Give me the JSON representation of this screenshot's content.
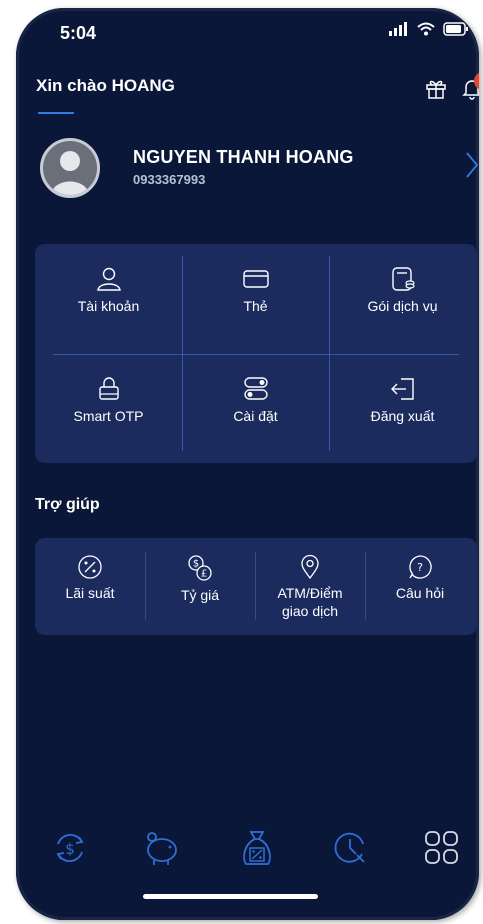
{
  "status_bar": {
    "time": "5:04"
  },
  "header": {
    "greeting": "Xin chào HOANG",
    "notification_count": "1"
  },
  "profile": {
    "name": "NGUYEN THANH HOANG",
    "phone": "0933367993"
  },
  "menu": [
    {
      "label": "Tài khoản",
      "icon": "user-icon"
    },
    {
      "label": "Thẻ",
      "icon": "card-icon"
    },
    {
      "label": "Gói dịch vụ",
      "icon": "service-package-icon"
    },
    {
      "label": "Smart OTP",
      "icon": "lock-icon"
    },
    {
      "label": "Cài đặt",
      "icon": "settings-toggle-icon"
    },
    {
      "label": "Đăng xuất",
      "icon": "logout-icon"
    }
  ],
  "help": {
    "title": "Trợ giúp",
    "items": [
      {
        "label": "Lãi suất",
        "icon": "percent-icon"
      },
      {
        "label": "Tỷ giá",
        "icon": "exchange-rate-icon"
      },
      {
        "label": "ATM/Điểm giao dịch",
        "icon": "location-pin-icon"
      },
      {
        "label": "Câu hỏi",
        "icon": "question-icon"
      }
    ]
  },
  "bottom_nav": [
    {
      "icon": "transfer-money-icon"
    },
    {
      "icon": "piggy-bank-icon"
    },
    {
      "icon": "money-bag-percent-icon"
    },
    {
      "icon": "history-clock-icon"
    },
    {
      "icon": "menu-grid-icon"
    }
  ],
  "colors": {
    "background": "#0b1738",
    "card": "#1b2b5e",
    "accent": "#2f7be0",
    "badge": "#e5462f"
  }
}
